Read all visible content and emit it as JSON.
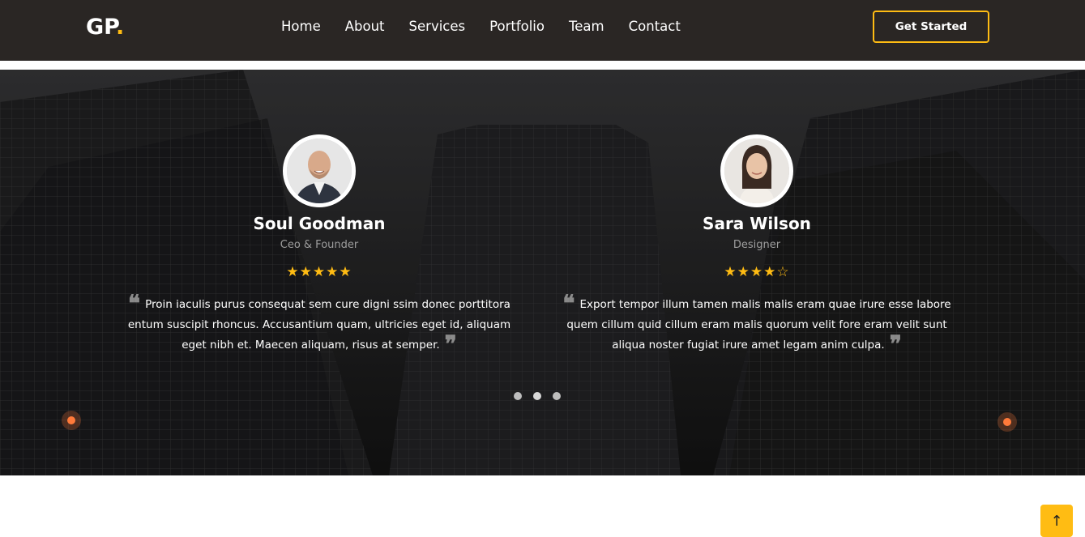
{
  "brand": {
    "logo_text": "GP",
    "logo_dot": ".",
    "accent": "#ffbc13"
  },
  "nav": {
    "items": [
      "Home",
      "About",
      "Services",
      "Portfolio",
      "Team",
      "Contact"
    ]
  },
  "header": {
    "cta_label": "Get Started"
  },
  "testimonials": [
    {
      "name": "Soul Goodman",
      "role": "Ceo & Founder",
      "rating": 5,
      "stars": "★★★★★",
      "quote": "Proin iaculis purus consequat sem cure digni ssim donec porttitora entum suscipit rhoncus. Accusantium quam, ultricies eget id, aliquam eget nibh et. Maecen aliquam, risus at semper."
    },
    {
      "name": "Sara Wilson",
      "role": "Designer",
      "rating": 4,
      "stars": "★★★★☆",
      "quote": "Export tempor illum tamen malis malis eram quae irure esse labore quem cillum quid cillum eram malis quorum velit fore eram velit sunt aliqua noster fugiat irure amet legam anim culpa."
    }
  ],
  "carousel": {
    "dots": 3,
    "active_index": 1
  },
  "icons": {
    "quote_open": "quote-left-icon",
    "quote_close": "quote-right-icon",
    "back_to_top": "arrow-up-icon"
  },
  "glyphs": {
    "quote_open": "❝",
    "quote_close": "❞",
    "arrow_up": "↑"
  }
}
